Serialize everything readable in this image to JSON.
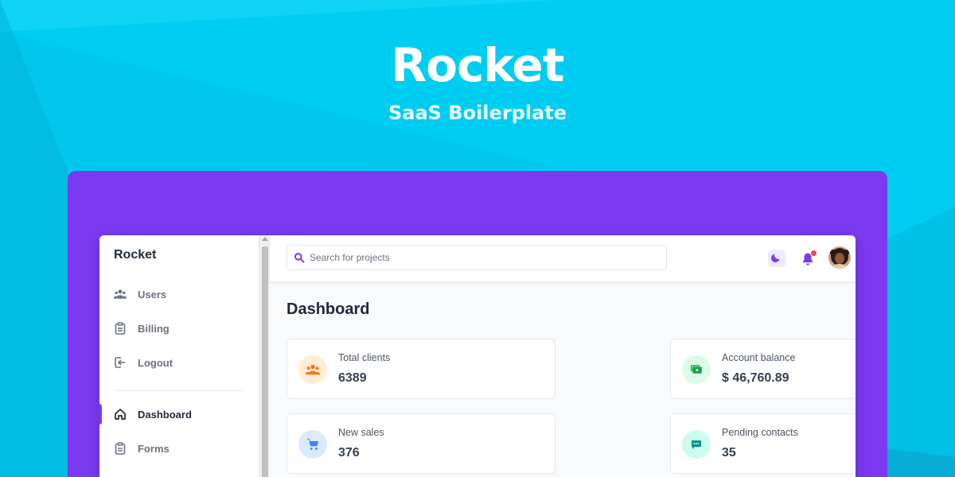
{
  "hero": {
    "title": "Rocket",
    "subtitle": "SaaS Boilerplate"
  },
  "colors": {
    "background": "#00cdf2",
    "panel": "#7b3af0",
    "accent": "#7c3aed"
  },
  "sidebar": {
    "brand": "Rocket",
    "items": [
      {
        "label": "Users",
        "icon": "users-icon"
      },
      {
        "label": "Billing",
        "icon": "clipboard-icon"
      },
      {
        "label": "Logout",
        "icon": "logout-icon"
      },
      {
        "label": "Dashboard",
        "icon": "home-icon",
        "active": true
      },
      {
        "label": "Forms",
        "icon": "clipboard-icon"
      }
    ]
  },
  "topbar": {
    "search_placeholder": "Search for projects"
  },
  "main": {
    "title": "Dashboard",
    "cards": [
      {
        "label": "Total clients",
        "value": "6389",
        "icon": "users-icon",
        "color": "#f97316"
      },
      {
        "label": "Account balance",
        "value": "$ 46,760.89",
        "icon": "cash-icon",
        "color": "#16a34a"
      },
      {
        "label": "New sales",
        "value": "376",
        "icon": "cart-icon",
        "color": "#3b82f6"
      },
      {
        "label": "Pending contacts",
        "value": "35",
        "icon": "chat-icon",
        "color": "#0d9488"
      }
    ]
  }
}
